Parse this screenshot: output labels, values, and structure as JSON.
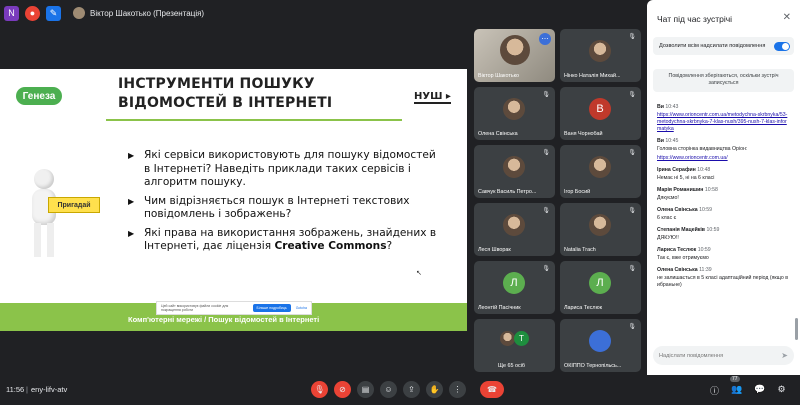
{
  "top_bar": {
    "presenter": "Віктор Шакотько (Презентація)",
    "icons": [
      "onenote-icon",
      "screen-record-icon",
      "pen-icon"
    ]
  },
  "slide": {
    "logo": "Генеза",
    "title": "ІНСТРУМЕНТИ ПОШУКУ ВІДОМОСТЕЙ В ІНТЕРНЕТІ",
    "brand": "НУШ",
    "sign": "Пригадай",
    "bullets": [
      "Які сервіси використовують для пошуку відомостей в Інтернеті? Наведіть приклади таких сервісів і алгоритм пошуку.",
      "Чим відрізняється пошук в Інтернеті текстових повідомлень і зображень?",
      "Які права на використання зображень, знайдених в Інтернеті, дає ліцензія "
    ],
    "bullet3_cc": "Creative Commons",
    "bullet3_tail": "?",
    "footer": "Комп'ютерні мережі / Пошук відомостей в Інтернеті",
    "cookie_text": "Цей сайт використовує файли cookie для покращення роботи",
    "cookie_button": "Більше подробиць",
    "cookie_link": "Gotcha"
  },
  "participants": [
    {
      "name": "Віктор Шакотько",
      "type": "video"
    },
    {
      "name": "Нінко Наталія Михай...",
      "type": "photo"
    },
    {
      "name": "Олена Свінська",
      "type": "photo"
    },
    {
      "name": "Ваня Чорнобай",
      "letter": "В",
      "color": "#c0392b"
    },
    {
      "name": "Савчук Василь Петро...",
      "type": "photo"
    },
    {
      "name": "Ігор Босий",
      "type": "photo"
    },
    {
      "name": "Леся Шворак",
      "type": "photo"
    },
    {
      "name": "Natalia Trach",
      "type": "photo"
    },
    {
      "name": "Леонтій Пасічник",
      "letter": "Л",
      "color": "#5cae4f"
    },
    {
      "name": "Лариса Теслюк",
      "letter": "Л",
      "color": "#5cae4f"
    },
    {
      "name": "Ще 65 осіб",
      "letter": "Т",
      "color": "#1e8e3e"
    },
    {
      "name": "ОКІППО Тернопільсь...",
      "type": "photo"
    }
  ],
  "chat": {
    "title": "Чат під час зустрічі",
    "toggle_label": "Дозволити всім надсилати повідомлення",
    "notice": "Повідомлення зберігаються, оскільки зустріч записується",
    "messages": [
      {
        "sender": "Ви",
        "time": "10:43",
        "link": "https://www.orioncentr.com.ua/metodychna-skrbnyka/53-metodychna-skrbnyka-7-klas-nush/395-nush-7-klas-informatyka"
      },
      {
        "sender": "Ви",
        "time": "10:45",
        "text": "Головна сторінка видавництва Оріон:",
        "link": "https://www.orioncentr.com.ua/"
      },
      {
        "sender": "Ірина Серафин",
        "time": "10:48",
        "text": "Немає ні 5, ні на 6 класі"
      },
      {
        "sender": "Марія Романишин",
        "time": "10:58",
        "text": "Дякуємо!"
      },
      {
        "sender": "Олена Свінська",
        "time": "10:59",
        "text": "6 клас є"
      },
      {
        "sender": "Степанія Мацейків",
        "time": "10:59",
        "text": "ДЯКУЮ!!"
      },
      {
        "sender": "Лариса Теслюк",
        "time": "10:59",
        "text": "Так є, вже отримуємо"
      },
      {
        "sender": "Олена Свінська",
        "time": "11:39",
        "text": "не залишається в 5 класі адаптаційний період (якщо вибраньне)"
      }
    ],
    "input_placeholder": "Надіслати повідомлення"
  },
  "bottom": {
    "time": "11:56",
    "separator": "|",
    "meeting_code": "eny-lifv-atv",
    "participants_count": "77"
  },
  "colors": {
    "accent": "#1a73e8",
    "danger": "#ea4335",
    "slide_green": "#8bc34a"
  }
}
